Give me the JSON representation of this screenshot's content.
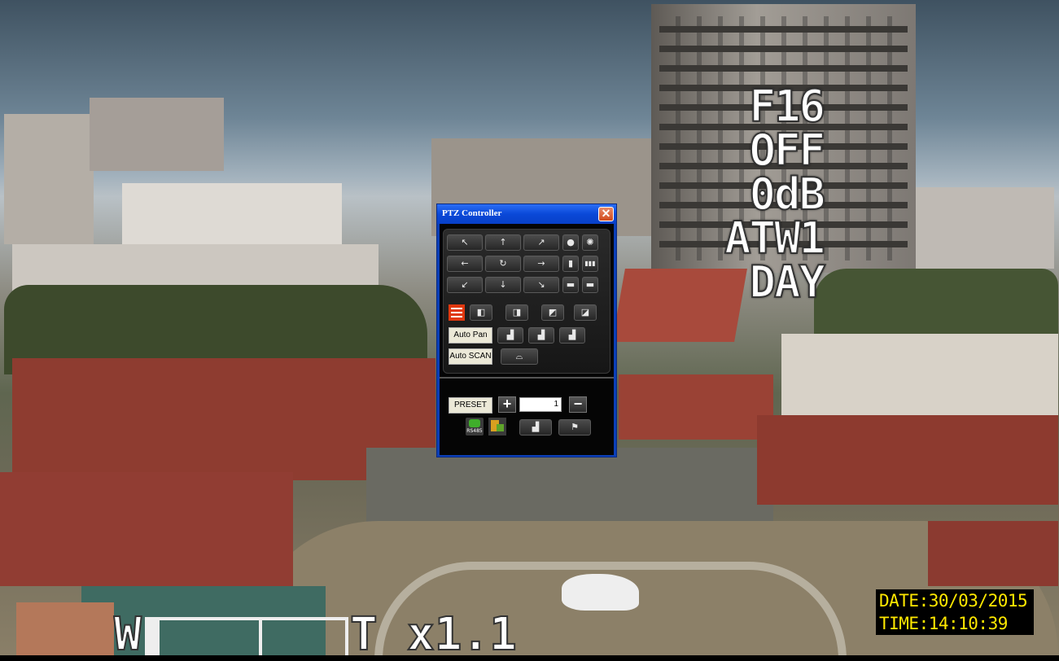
{
  "osd": {
    "iris": "F16",
    "blc": "OFF",
    "gain": "0dB",
    "white_balance": "ATW1",
    "mode": "DAY",
    "date": "DATE:30/03/2015",
    "time": "TIME:14:10:39",
    "zoom_wide": "W",
    "zoom_tele": "T",
    "zoom_value": "x1.1"
  },
  "ptz": {
    "title": "PTZ Controller",
    "close_label": "✕",
    "dir": {
      "up_left": "↖",
      "up": "↑",
      "up_right": "↗",
      "left": "←",
      "home": "↻",
      "right": "→",
      "down_left": "↙",
      "down": "↓",
      "down_right": "↘"
    },
    "auto_pan": "Auto Pan",
    "auto_scan": "Auto SCAN",
    "preset": "PRESET",
    "preset_value": "1",
    "plus": "+",
    "minus": "−",
    "rs485": "RS485"
  },
  "colors": {
    "title_bar": "#0a48d8",
    "osd_date": "#ffe800",
    "close": "#d24b1c"
  }
}
